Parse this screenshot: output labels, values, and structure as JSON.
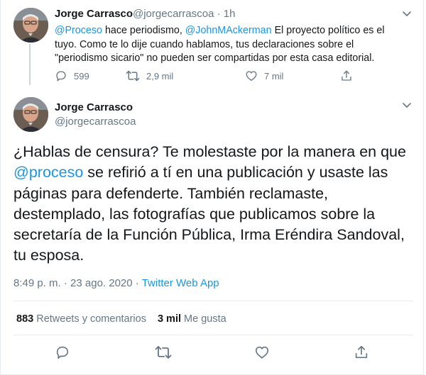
{
  "reply_tweet": {
    "author_name": "Jorge Carrasco",
    "author_handle": "@jorgecarrascoa",
    "time_ago": "1h",
    "mention_1": "@Proceso",
    "text_part_1": " hace periodismo, ",
    "mention_2": "@JohnMAckerman",
    "text_part_2": " El proyecto político es el tuyo. Como te lo dije cuando hablamos, tus declaraciones sobre el \"periodismo sicario\" no pueden ser compartidas por esta casa editorial.",
    "reply_count": "599",
    "retweet_count": "2,9 mil",
    "like_count": "7 mil"
  },
  "main_tweet": {
    "author_name": "Jorge Carrasco",
    "author_handle": "@jorgecarrascoa",
    "text_part_1": "¿Hablas de censura? Te molestaste por la manera en que ",
    "mention": "@proceso",
    "text_part_2": " se refirió  a tí en una publicación y usaste las páginas para defenderte. También reclamaste, destemplado, las fotografías que publicamos sobre la secretaría de la Función Pública, Irma Eréndira Sandoval, tu esposa.",
    "timestamp": "8:49 p. m. · 23 ago. 2020 · ",
    "source": "Twitter Web App",
    "retweets_count": "883",
    "retweets_label": "Retweets y comentarios",
    "likes_count": "3 mil",
    "likes_label": "Me gusta"
  },
  "colors": {
    "link": "#1b95e0",
    "muted": "#657786",
    "text": "#14171a"
  },
  "icons": [
    "chevron-down-icon",
    "reply-icon",
    "retweet-icon",
    "like-icon",
    "share-icon"
  ]
}
